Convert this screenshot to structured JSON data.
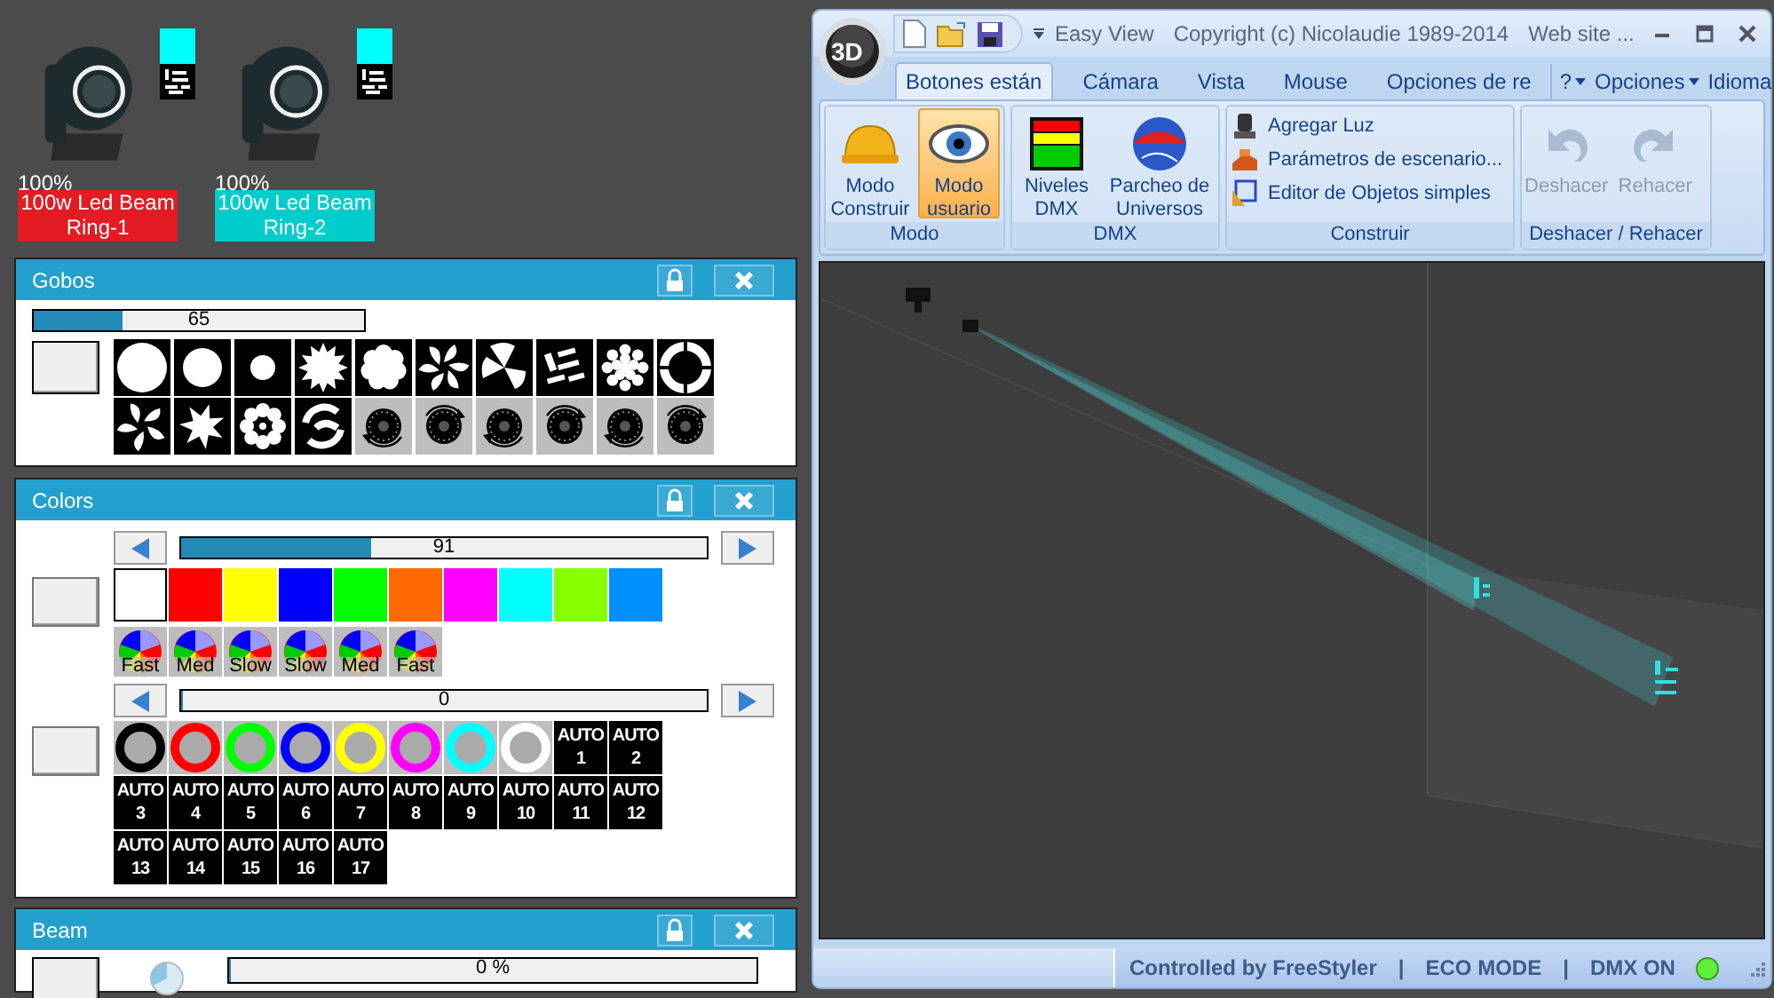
{
  "fixtures": [
    {
      "percent": "100%",
      "name": "100w Led Beam Ring-1",
      "color": "#e31b23",
      "swatch": {
        "color": "#00ffff"
      }
    },
    {
      "percent": "100%",
      "name": "100w Led Beam Ring-2",
      "color": "#00cccc",
      "swatch": {
        "color": "#00ffff"
      }
    }
  ],
  "gobos_panel": {
    "title": "Gobos",
    "slider": {
      "level": 0.27,
      "reading": "65"
    }
  },
  "colors_panel": {
    "title": "Colors",
    "wheel_slider": {
      "level": 0.36,
      "reading": "91"
    },
    "swatches": [
      {
        "color": "#ffffff"
      },
      {
        "color": "#ff0000"
      },
      {
        "color": "#ffff00"
      },
      {
        "color": "#0000ff"
      },
      {
        "color": "#00ff00"
      },
      {
        "color": "#ff6a00"
      },
      {
        "color": "#ff00ff"
      },
      {
        "color": "#00ffff"
      },
      {
        "color": "#88ff00"
      },
      {
        "color": "#0090ff"
      }
    ],
    "speed_buttons": [
      "Fast",
      "Med",
      "Slow",
      "Slow",
      "Med",
      "Fast"
    ],
    "ring_slider": {
      "level": 0,
      "reading": "0"
    },
    "rings": [
      {
        "color": "#000000"
      },
      {
        "color": "#ff0000"
      },
      {
        "color": "#00ff00"
      },
      {
        "color": "#0000ff"
      },
      {
        "color": "#ffff00"
      },
      {
        "color": "#ff00ff"
      },
      {
        "color": "#00ffff"
      },
      {
        "color": "#ffffff"
      }
    ],
    "auto_buttons": [
      "AUTO 1",
      "AUTO 2",
      "AUTO 3",
      "AUTO 4",
      "AUTO 5",
      "AUTO 6",
      "AUTO 7",
      "AUTO 8",
      "AUTO 9",
      "AUTO 10",
      "AUTO 11",
      "AUTO 12",
      "AUTO 13",
      "AUTO 14",
      "AUTO 15",
      "AUTO 16",
      "AUTO 17"
    ]
  },
  "beam_panel": {
    "title": "Beam",
    "slider": {
      "level": 0,
      "reading": "0 %"
    }
  },
  "window": {
    "logo": "3D",
    "title_items": [
      "Easy View",
      "Copyright (c) Nicolaudie 1989-2014",
      "Web site ..."
    ],
    "tabs": [
      {
        "label": "Botones están",
        "selected": true
      },
      {
        "label": "Cámara",
        "selected": false
      },
      {
        "label": "Vista",
        "selected": false
      },
      {
        "label": "Mouse",
        "selected": false
      },
      {
        "label": "Opciones de re",
        "selected": false
      }
    ],
    "menus": [
      "?",
      "Opciones",
      "Idioma"
    ],
    "groups": [
      {
        "label": "Modo",
        "kind": "large",
        "buttons": [
          {
            "label": "Modo Construir",
            "selected": false,
            "disabled": false
          },
          {
            "label": "Modo usuario",
            "selected": true,
            "disabled": false
          }
        ]
      },
      {
        "label": "DMX",
        "kind": "large",
        "buttons": [
          {
            "label": "Niveles DMX",
            "selected": false,
            "disabled": false
          },
          {
            "label": "Parcheo de Universos",
            "selected": false,
            "disabled": false
          }
        ]
      },
      {
        "label": "Construir",
        "kind": "small",
        "buttons": [
          {
            "label": "Agregar Luz",
            "disabled": false
          },
          {
            "label": "Parámetros de escenario...",
            "disabled": false
          },
          {
            "label": "Editor de Objetos simples",
            "disabled": false
          }
        ]
      },
      {
        "label": "Deshacer / Rehacer",
        "kind": "large",
        "buttons": [
          {
            "label": "Deshacer",
            "selected": false,
            "disabled": true
          },
          {
            "label": "Rehacer",
            "selected": false,
            "disabled": true
          }
        ]
      }
    ],
    "status": [
      "Controlled by FreeStyler",
      "|",
      "ECO MODE",
      "|",
      "DMX ON"
    ],
    "dmx_on": true
  }
}
